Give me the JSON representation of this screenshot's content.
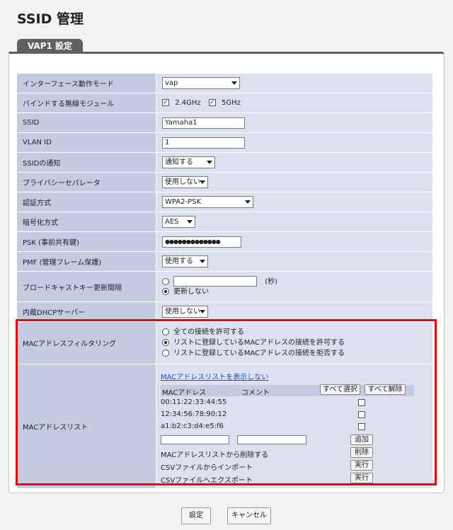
{
  "page": {
    "title": "SSID 管理",
    "tab": "VAP1 設定"
  },
  "rows": {
    "interface_mode": {
      "label": "インターフェース動作モード",
      "value": "vap"
    },
    "bind_module": {
      "label": "バインドする無線モジュール",
      "opt1": "2.4GHz",
      "opt2": "5GHz"
    },
    "ssid": {
      "label": "SSID",
      "value": "Yamaha1"
    },
    "vlan": {
      "label": "VLAN ID",
      "value": "1"
    },
    "ssid_notify": {
      "label": "SSIDの通知",
      "value": "通知する"
    },
    "privacy": {
      "label": "プライバシーセパレータ",
      "value": "使用しない"
    },
    "auth": {
      "label": "認証方式",
      "value": "WPA2-PSK"
    },
    "cipher": {
      "label": "暗号化方式",
      "value": "AES"
    },
    "psk": {
      "label": "PSK (事前共有鍵)",
      "value": "●●●●●●●●●●●●●"
    },
    "pmf": {
      "label": "PMF (管理フレーム保護)",
      "value": "使用する"
    },
    "broadcast": {
      "label": "ブロードキャストキー更新間隔",
      "unit": "(秒)",
      "no_update": "更新しない"
    },
    "dhcp": {
      "label": "内蔵DHCPサーバー",
      "value": "使用しない"
    },
    "mac_filter": {
      "label": "MACアドレスフィルタリング",
      "options": [
        "全ての接続を許可する",
        "リストに登録しているMACアドレスの接続を許可する",
        "リストに登録しているMACアドレスの接続を拒否する"
      ],
      "selected_index": 1
    },
    "mac_list": {
      "label": "MACアドレスリスト",
      "hide_link": "MACアドレスリストを表示しない",
      "col_mac": "MACアドレス",
      "col_comment": "コメント",
      "select_all": "すべて選択",
      "deselect_all": "すべて解除",
      "entries": [
        "00:11:22:33:44:55",
        "12:34:56:78:90:12",
        "a1:b2:c3:d4:e5:f6"
      ],
      "add": "追加",
      "delete_label": "MACアドレスリストから削除する",
      "delete": "削除",
      "import_label": "CSVファイルからインポート",
      "export_label": "CSVファイルへエクスポート",
      "run": "実行"
    }
  },
  "footer": {
    "ok": "設定",
    "cancel": "キャンセル"
  },
  "colors": {
    "highlight": "#e8070c",
    "label_bg": "#c5cbe1",
    "value_bg": "#dde1ef",
    "tab_bg": "#606060"
  }
}
